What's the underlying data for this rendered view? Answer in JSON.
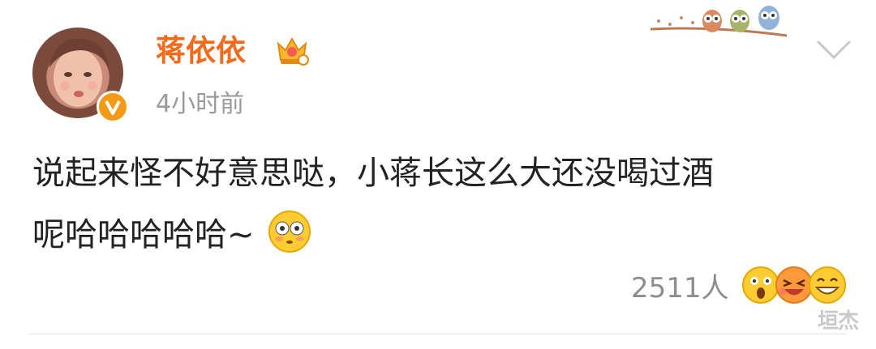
{
  "post": {
    "username": "蒋依依",
    "timestamp": "4小时前",
    "content_line1": "说起来怪不好意思哒，小蒋长这么大还没喝过酒",
    "content_line2": "呢哈哈哈哈哈~",
    "reactions_count": "2511人"
  },
  "watermark": "垣杰",
  "icons": {
    "avatar": "avatar",
    "verified": "verified-v-badge-icon",
    "crown": "crown-vip-icon",
    "owls": "owls-on-branch-decoration",
    "chevron": "chevron-down-icon",
    "emoji_inline": "flushed-face-emoji",
    "reaction_1": "surprised-face-emoji",
    "reaction_2": "laughing-face-emoji",
    "reaction_3": "grinning-face-emoji"
  },
  "colors": {
    "username": "#f26b1d",
    "text": "#222222",
    "meta": "#9a9a9a",
    "badge": "#f59a17"
  }
}
